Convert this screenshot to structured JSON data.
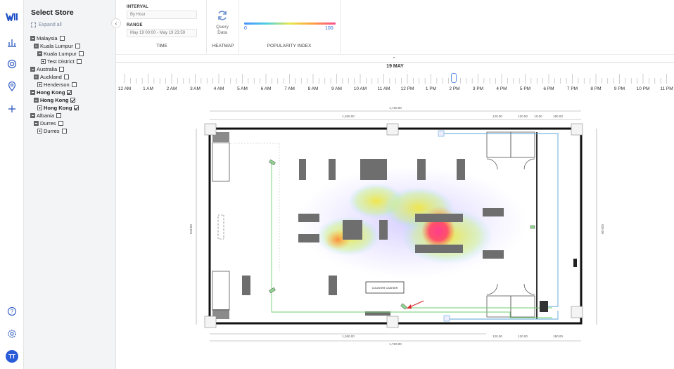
{
  "rail": {
    "logo": "logo-icon",
    "items": [
      "bar-chart-icon",
      "heatmap-icon",
      "location-pin-icon",
      "plus-icon"
    ],
    "bottom": [
      "help-icon",
      "settings-icon"
    ],
    "avatar_initials": "TT"
  },
  "store_panel": {
    "title": "Select Store",
    "expand_all": "Expand all",
    "tree": [
      {
        "label": "Malaysia",
        "level": 0,
        "toggle": "minus",
        "checked": false,
        "bold": false
      },
      {
        "label": "Kuala Lumpur",
        "level": 1,
        "toggle": "minus",
        "checked": false,
        "bold": false
      },
      {
        "label": "Kuala Lumpur",
        "level": 2,
        "toggle": "minus",
        "checked": false,
        "bold": false
      },
      {
        "label": "Test District",
        "level": 3,
        "toggle": "plus",
        "checked": false,
        "bold": false
      },
      {
        "label": "Australia",
        "level": 0,
        "toggle": "minus",
        "checked": false,
        "bold": false
      },
      {
        "label": "Auckland",
        "level": 1,
        "toggle": "minus",
        "checked": false,
        "bold": false
      },
      {
        "label": "Henderson",
        "level": 2,
        "toggle": "plus",
        "checked": false,
        "bold": false
      },
      {
        "label": "Hong Kong",
        "level": 0,
        "toggle": "minus",
        "checked": true,
        "bold": true
      },
      {
        "label": "Hong Kong",
        "level": 1,
        "toggle": "minus",
        "checked": true,
        "bold": true
      },
      {
        "label": "Hong Kong",
        "level": 2,
        "toggle": "plus",
        "checked": true,
        "bold": true
      },
      {
        "label": "Albania",
        "level": 0,
        "toggle": "minus",
        "checked": false,
        "bold": false
      },
      {
        "label": "Durres",
        "level": 1,
        "toggle": "minus",
        "checked": false,
        "bold": false
      },
      {
        "label": "Durres",
        "level": 2,
        "toggle": "plus",
        "checked": false,
        "bold": false
      }
    ]
  },
  "controls": {
    "interval_label": "INTERVAL",
    "interval_value": "By Hour",
    "range_label": "RANGE",
    "range_value": "May 19 00:00 - May 19 23:59",
    "time_section": "TIME",
    "query_label": "Query Data",
    "heatmap_section": "HEATMAP",
    "popularity_section": "POPULARITY INDEX",
    "popularity_min": "0",
    "popularity_max": "100"
  },
  "timeline": {
    "date": "19 MAY",
    "hours": [
      "12 AM",
      "1 AM",
      "2 AM",
      "3 AM",
      "4 AM",
      "5 AM",
      "6 AM",
      "7 AM",
      "8 AM",
      "9 AM",
      "10 AM",
      "11 AM",
      "12 PM",
      "1 PM",
      "2 PM",
      "3 PM",
      "4 PM",
      "5 PM",
      "6 PM",
      "7 PM",
      "8 PM",
      "9 PM",
      "10 PM",
      "11 PM"
    ],
    "selected_hour": "2 PM"
  },
  "floorplan": {
    "dim_total": "1,720.00",
    "dim_left": "1,260.00",
    "dim_a": "120.00",
    "dim_b": "120.00",
    "dim_c": "10.00",
    "dim_d": "190.00",
    "dim_height": "843.00",
    "dim_height_right": "826.00",
    "counter_label": "COUNTER CASHIER",
    "colors": {
      "wall": "#111111",
      "column": "#6e6e6e",
      "route_green": "#6fcf6f",
      "route_blue": "#5aa6d8",
      "arrow": "#d9262a"
    }
  }
}
